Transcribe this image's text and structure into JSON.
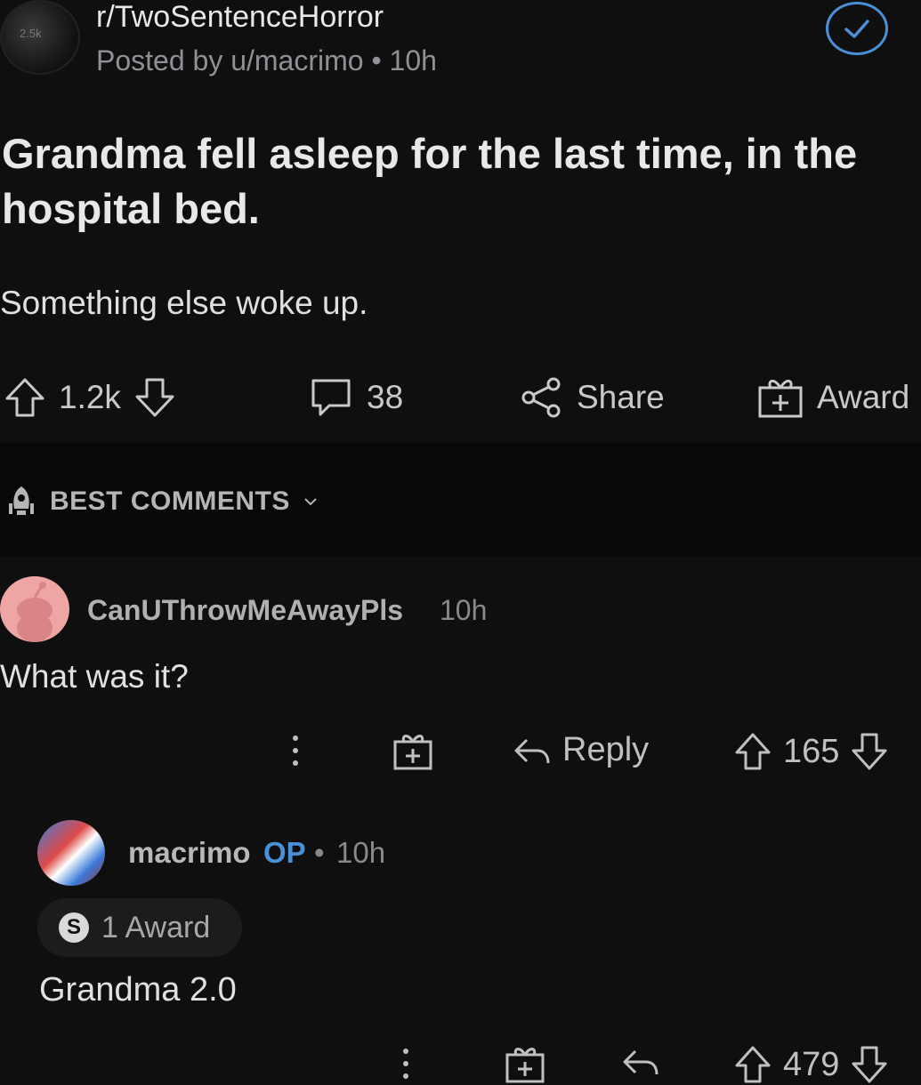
{
  "post": {
    "subreddit": "r/TwoSentenceHorror",
    "posted_by": "Posted by u/macrimo",
    "separator": "•",
    "time": "10h",
    "title": "Grandma fell asleep for the last time, in the hospital bed.",
    "body": "Something else woke up.",
    "avatar_text": "2.5k",
    "upvotes": "1.2k",
    "comments": "38",
    "share_label": "Share",
    "award_label": "Award"
  },
  "comments_header": {
    "label": "BEST COMMENTS"
  },
  "comments": [
    {
      "author": "CanUThrowMeAwayPls",
      "time": "10h",
      "text": "What was it?",
      "reply_label": "Reply",
      "score": "165"
    }
  ],
  "reply": {
    "author": "macrimo",
    "op_badge": "OP",
    "separator": "•",
    "time": "10h",
    "award_text": "1 Award",
    "award_icon_letter": "S",
    "text": "Grandma 2.0",
    "score": "479"
  },
  "colors": {
    "background": "#0f0f0f",
    "accent_blue": "#4a90d9",
    "text_primary": "#e0e0e0",
    "text_muted": "#8e9195"
  }
}
